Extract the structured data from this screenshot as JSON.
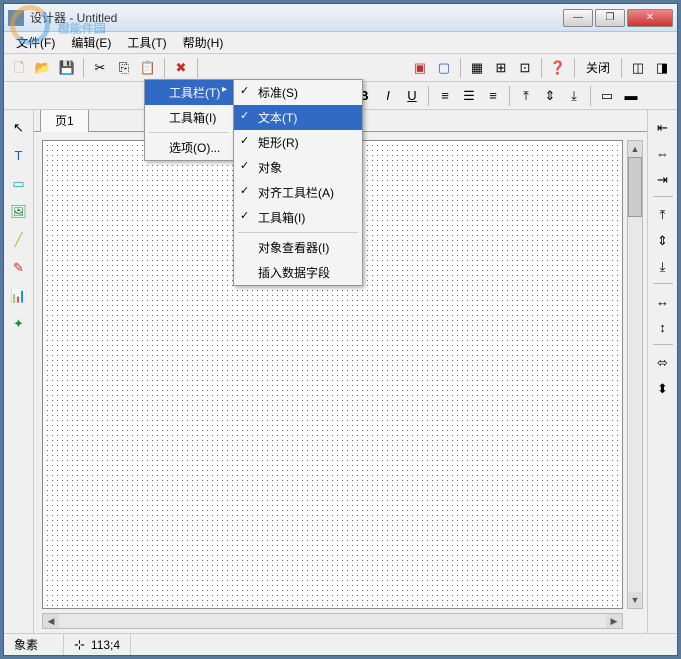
{
  "window": {
    "title": "设计器 - Untitled",
    "buttons": {
      "min": "—",
      "max": "❐",
      "close": "✕"
    }
  },
  "menubar": {
    "file": "文件(F)",
    "edit": "编辑(E)",
    "tools": "工具(T)",
    "help": "帮助(H)"
  },
  "tools_menu": {
    "toolbars": "工具栏(T)",
    "toolbox": "工具箱(I)",
    "options": "选项(O)..."
  },
  "toolbars_submenu": {
    "standard": {
      "label": "标准(S)",
      "checked": true
    },
    "text": {
      "label": "文本(T)",
      "checked": true
    },
    "rectangle": {
      "label": "矩形(R)",
      "checked": true
    },
    "object": {
      "label": "对象",
      "checked": true
    },
    "align_toolbar": {
      "label": "对齐工具栏(A)",
      "checked": true
    },
    "toolbox": {
      "label": "工具箱(I)",
      "checked": true
    },
    "object_viewer": {
      "label": "对象查看器(I)",
      "checked": false
    },
    "insert_data_field": {
      "label": "插入数据字段",
      "checked": false
    }
  },
  "toolbar": {
    "close_label": "关闭",
    "font_placeholder": "",
    "size_placeholder": ""
  },
  "left_tools": {
    "pointer": "↖",
    "text": "T",
    "rect": "▭",
    "image": "🖼",
    "line": "╱",
    "pen": "✎",
    "chart": "📊",
    "star": "✦"
  },
  "right_tools": {
    "align_left": "⇤",
    "align_center_h": "⇔",
    "align_right": "⇥",
    "align_top": "⤒",
    "align_center_v": "⇕",
    "align_bottom": "⤓",
    "dist_h": "↔",
    "dist_v": "↕",
    "same_w": "⬄",
    "same_h": "⬍"
  },
  "tabs": {
    "page1": "页1"
  },
  "statusbar": {
    "unit": "象素",
    "pos": "113;4"
  },
  "watermark": "橙能件园"
}
